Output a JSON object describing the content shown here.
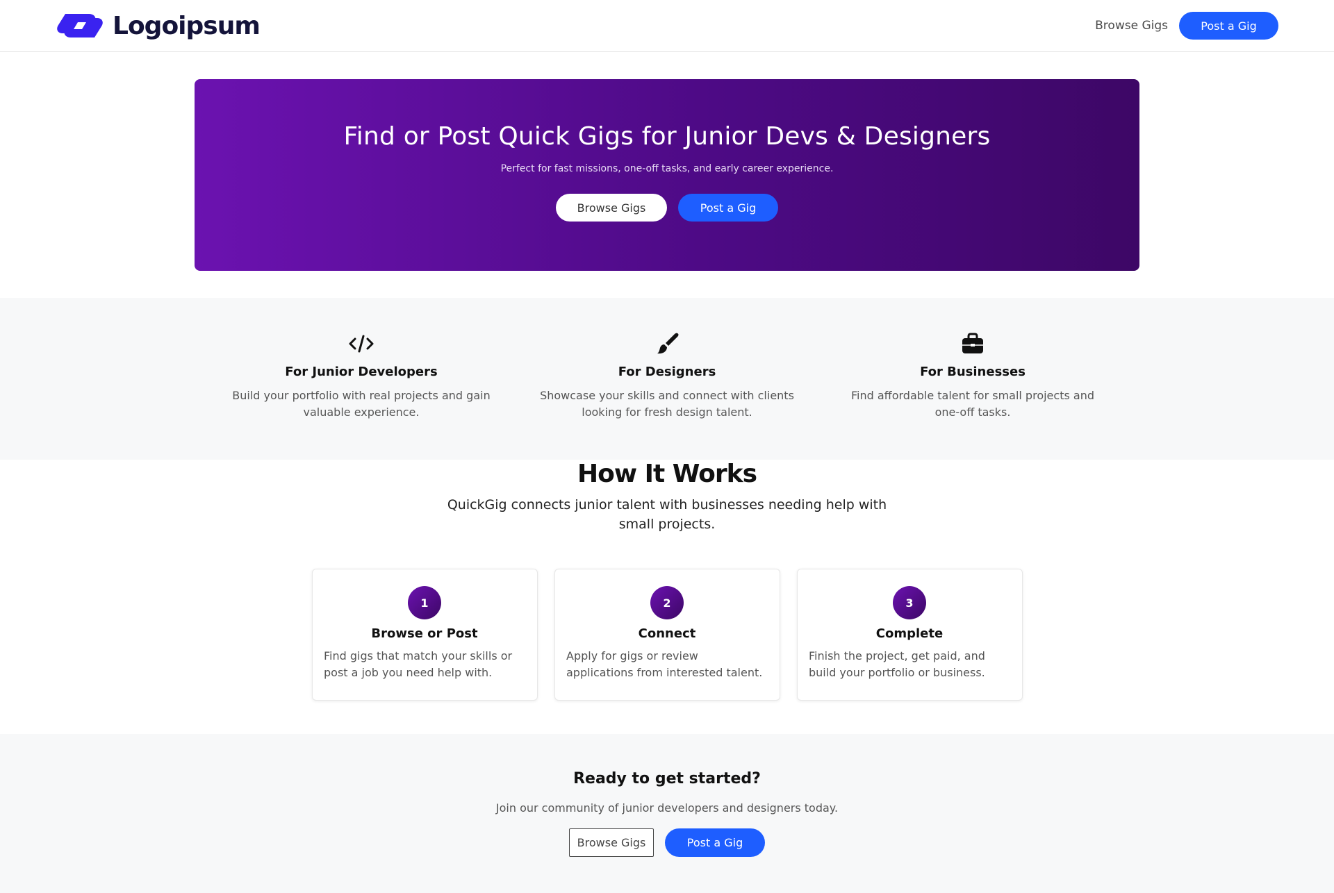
{
  "brand": {
    "name": "Logoipsum",
    "accent": "#3a22f0"
  },
  "nav": {
    "browse_label": "Browse Gigs",
    "post_label": "Post a Gig"
  },
  "hero": {
    "title": "Find or Post Quick Gigs for Junior Devs & Designers",
    "subtitle": "Perfect for fast missions, one-off tasks, and early career experience.",
    "browse_label": "Browse Gigs",
    "post_label": "Post a Gig",
    "gradient_start": "#6b12b0",
    "gradient_end": "#3d0766"
  },
  "audience": [
    {
      "icon": "code-icon",
      "title": "For Junior Developers",
      "desc": "Build your portfolio with real projects and gain valuable experience."
    },
    {
      "icon": "paintbrush-icon",
      "title": "For Designers",
      "desc": "Showcase your skills and connect with clients looking for fresh design talent."
    },
    {
      "icon": "briefcase-icon",
      "title": "For Businesses",
      "desc": "Find affordable talent for small projects and one-off tasks."
    }
  ],
  "how": {
    "title": "How It Works",
    "subtitle": "QuickGig connects junior talent with businesses needing help with small projects.",
    "steps": [
      {
        "num": "1",
        "title": "Browse or Post",
        "desc": "Find gigs that match your skills or post a job you need help with."
      },
      {
        "num": "2",
        "title": "Connect",
        "desc": "Apply for gigs or review applications from interested talent."
      },
      {
        "num": "3",
        "title": "Complete",
        "desc": "Finish the project, get paid, and build your portfolio or business."
      }
    ]
  },
  "cta": {
    "title": "Ready to get started?",
    "subtitle": "Join our community of junior developers and designers today.",
    "browse_label": "Browse Gigs",
    "post_label": "Post a Gig"
  },
  "colors": {
    "primary_button": "#1e5eff"
  }
}
